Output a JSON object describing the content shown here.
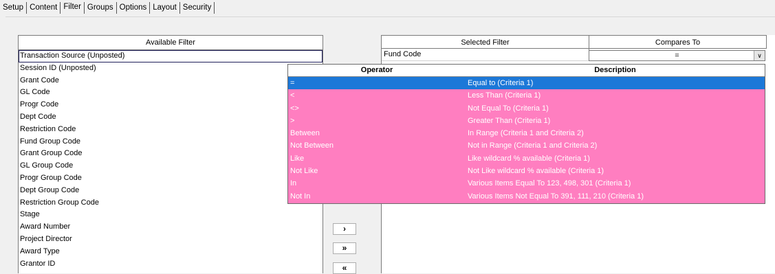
{
  "tabs": [
    "Setup",
    "Content",
    "Filter",
    "Groups",
    "Options",
    "Layout",
    "Security"
  ],
  "available": {
    "header": "Available Filter",
    "items": [
      "Transaction Source (Unposted)",
      "Session ID (Unposted)",
      "Grant Code",
      "GL Code",
      "Progr Code",
      "Dept Code",
      "Restriction Code",
      "Fund Group Code",
      "Grant Group Code",
      "GL Group Code",
      "Progr Group Code",
      "Dept Group Code",
      "Restriction Group Code",
      "Stage",
      "Award Number",
      "Project Director",
      "Award Type",
      "Grantor ID"
    ]
  },
  "buttons": {
    "add_one": "›",
    "add_all": "»",
    "remove_all": "«"
  },
  "selected": {
    "header_filter": "Selected Filter",
    "header_compares": "Compares To",
    "row_filter": "Fund Code",
    "row_compares": "="
  },
  "operator_dropdown": {
    "header_operator": "Operator",
    "header_description": "Description",
    "rows": [
      {
        "op": "=",
        "desc": "Equal to (Criteria 1)"
      },
      {
        "op": "<",
        "desc": "Less Than (Criteria 1)"
      },
      {
        "op": "<>",
        "desc": "Not Equal To (Criteria 1)"
      },
      {
        "op": ">",
        "desc": "Greater Than (Criteria 1)"
      },
      {
        "op": "Between",
        "desc": "In Range (Criteria 1 and Criteria 2)"
      },
      {
        "op": "Not Between",
        "desc": "Not in Range (Criteria 1 and Criteria 2)"
      },
      {
        "op": "Like",
        "desc": "Like wildcard % available (Criteria 1)"
      },
      {
        "op": "Not Like",
        "desc": "Not Like  wildcard % available (Criteria 1)"
      },
      {
        "op": "In",
        "desc": "Various Items Equal To 123, 498, 301 (Criteria 1)"
      },
      {
        "op": "Not In",
        "desc": "Various Items Not Equal To 391, 111, 210  (Criteria 1)"
      }
    ]
  },
  "colors": {
    "dropdown_bg": "#ff7ec0",
    "selection": "#1c78d8"
  }
}
